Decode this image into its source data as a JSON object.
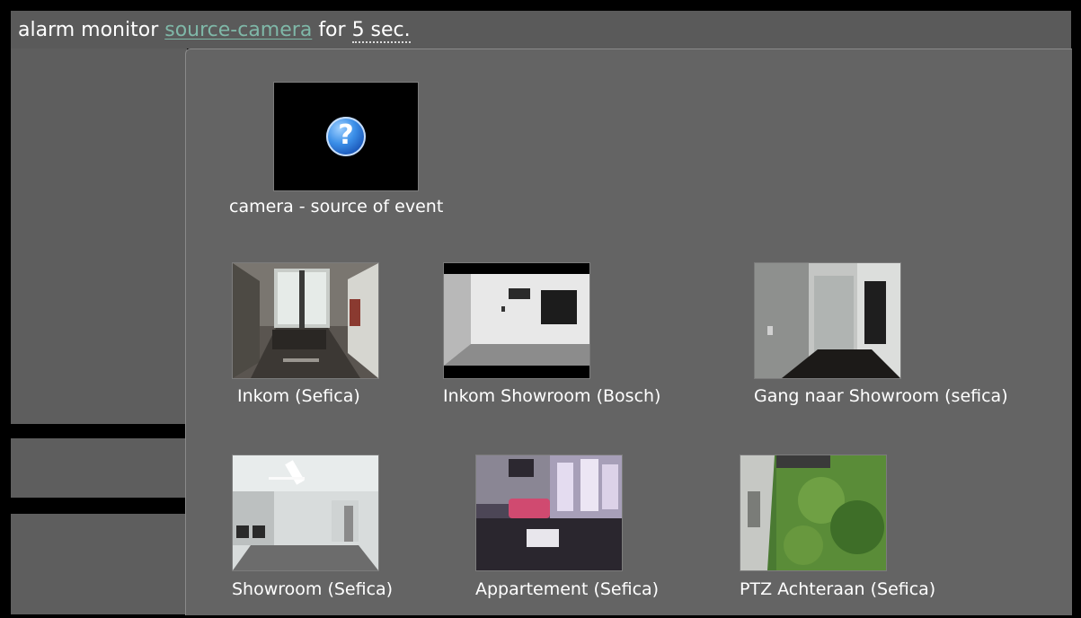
{
  "header": {
    "prefix": "alarm monitor",
    "source_link": "source-camera",
    "for_word": "for",
    "duration": "5 sec."
  },
  "source": {
    "label": "camera - source of event",
    "icon": "question-mark-icon"
  },
  "cameras": [
    {
      "label": "Inkom (Sefica)"
    },
    {
      "label": "Inkom Showroom (Bosch)"
    },
    {
      "label": "Gang naar Showroom (sefica)"
    },
    {
      "label": "Showroom (Sefica)"
    },
    {
      "label": "Appartement (Sefica)"
    },
    {
      "label": "PTZ Achteraan (Sefica)"
    }
  ]
}
